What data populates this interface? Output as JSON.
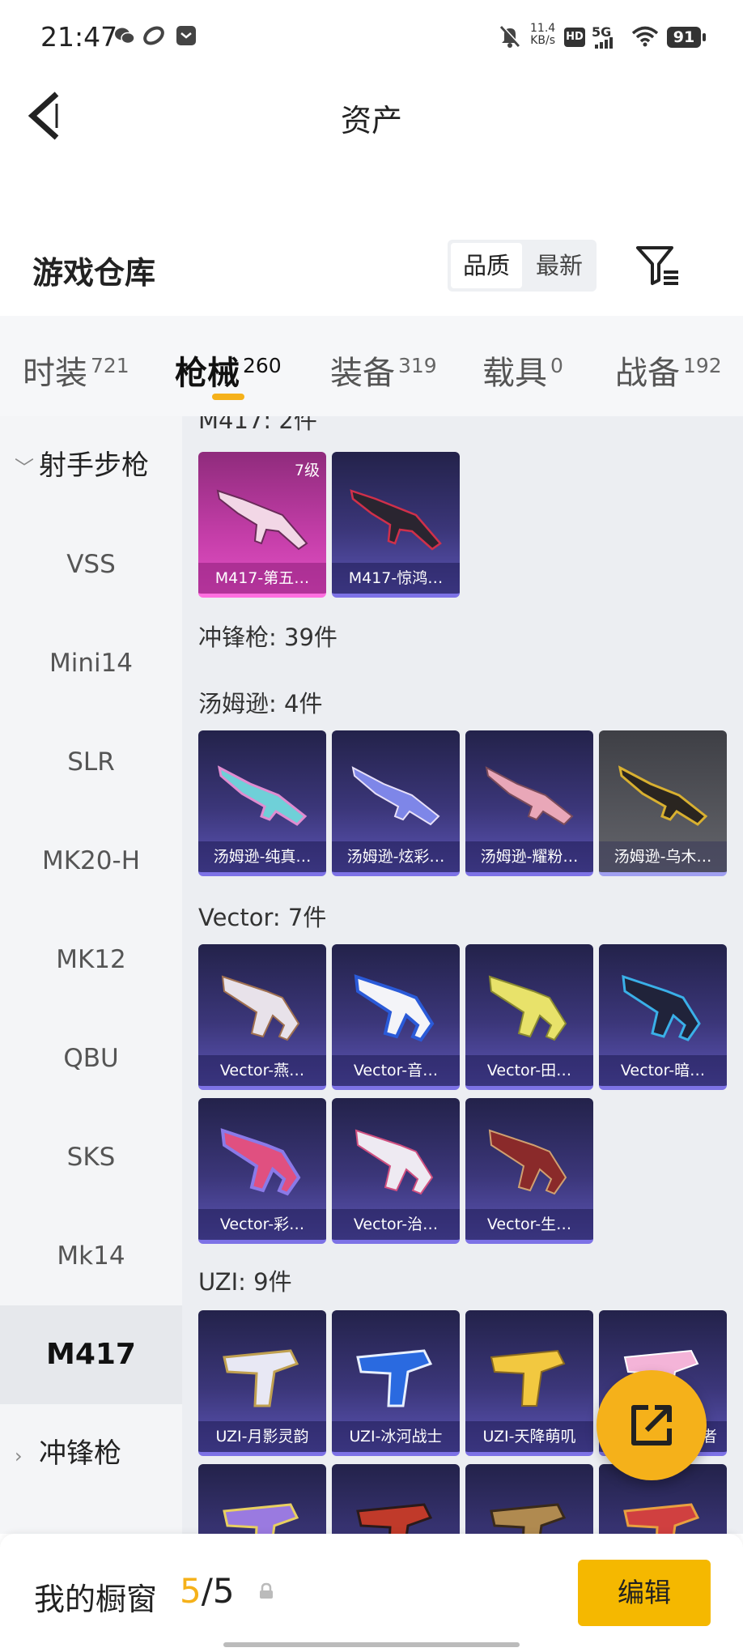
{
  "status_bar": {
    "time": "21:47",
    "speed_value": "11.4",
    "speed_unit": "KB/s",
    "hd": "HD",
    "network": "5G",
    "battery": "91"
  },
  "header": {
    "title": "资产",
    "back_icon": "chevron-left-icon"
  },
  "section": {
    "title": "游戏仓库",
    "sort_options": [
      "品质",
      "最新"
    ],
    "sort_selected": "品质",
    "filter_icon": "filter-list-icon"
  },
  "tabs": [
    {
      "label": "时装",
      "count": "721"
    },
    {
      "label": "枪械",
      "count": "260",
      "active": true
    },
    {
      "label": "装备",
      "count": "319"
    },
    {
      "label": "载具",
      "count": "0"
    },
    {
      "label": "战备",
      "count": "192"
    }
  ],
  "sidebar": {
    "group_open": "射手步枪",
    "items": [
      "VSS",
      "Mini14",
      "SLR",
      "MK20-H",
      "MK12",
      "QBU",
      "SKS",
      "Mk14",
      "M417"
    ],
    "selected": "M417",
    "group_closed": "冲锋枪"
  },
  "content": {
    "m417_label": "M417: 2件",
    "m417_items": [
      {
        "name": "M417-第五…",
        "level": "7级",
        "rarity": "pink"
      },
      {
        "name": "M417-惊鸿…"
      }
    ],
    "smg_label": "冲锋枪: 39件",
    "thompson_label": "汤姆逊: 4件",
    "thompson_items": [
      {
        "name": "汤姆逊-纯真…"
      },
      {
        "name": "汤姆逊-炫彩…"
      },
      {
        "name": "汤姆逊-耀粉…"
      },
      {
        "name": "汤姆逊-乌木…",
        "rarity": "grey"
      }
    ],
    "vector_label": "Vector: 7件",
    "vector_items": [
      {
        "name": "Vector-燕…"
      },
      {
        "name": "Vector-音…"
      },
      {
        "name": "Vector-田…"
      },
      {
        "name": "Vector-暗…"
      },
      {
        "name": "Vector-彩…"
      },
      {
        "name": "Vector-治…"
      },
      {
        "name": "Vector-生…"
      }
    ],
    "uzi_label": "UZI: 9件",
    "uzi_items": [
      {
        "name": "UZI-月影灵韵"
      },
      {
        "name": "UZI-冰河战士"
      },
      {
        "name": "UZI-天降萌叽"
      },
      {
        "name": "者"
      }
    ]
  },
  "floating": {
    "share_icon": "external-link-icon"
  },
  "bottom_bar": {
    "showcase_label": "我的橱窗",
    "count_current": "5",
    "count_total": "/5",
    "lock_icon": "lock-icon",
    "edit_label": "编辑"
  },
  "colors": {
    "accent": "#f5b11a",
    "card_purple": "#3b3679",
    "card_pink": "#c53ea9"
  }
}
